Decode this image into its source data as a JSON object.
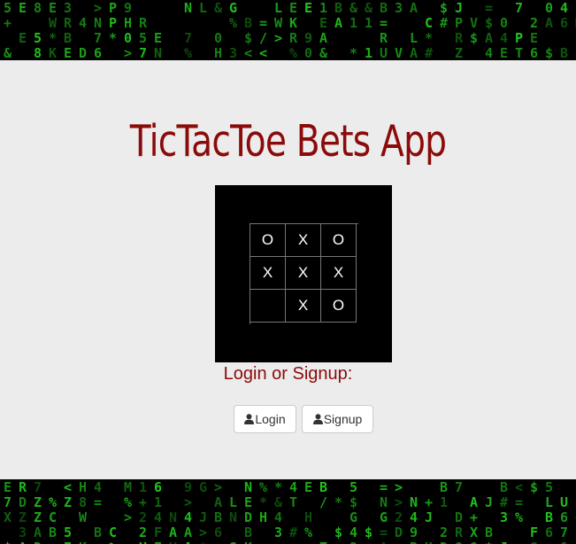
{
  "header": {
    "title": "TicTacToe Bets App"
  },
  "board": {
    "cells": [
      "O",
      "X",
      "O",
      "X",
      "X",
      "X",
      "",
      "X",
      "O"
    ]
  },
  "auth": {
    "prompt": "Login or Signup:",
    "login_label": "Login",
    "signup_label": "Signup"
  },
  "colors": {
    "accent": "#8b0a0a",
    "matrix_green": "#22c41e"
  }
}
